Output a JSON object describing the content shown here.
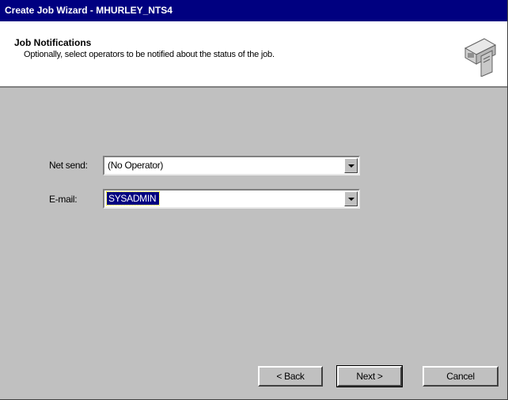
{
  "window": {
    "title": "Create Job Wizard - MHURLEY_NTS4"
  },
  "header": {
    "title": "Job Notifications",
    "subtitle": "Optionally, select operators to be notified about the status of the job.",
    "icon": "server-computer-icon"
  },
  "form": {
    "net_send": {
      "label": "Net send:",
      "value": "(No Operator)"
    },
    "email": {
      "label": "E-mail:",
      "value": "SYSADMIN"
    }
  },
  "buttons": {
    "back": "< Back",
    "next": "Next >",
    "cancel": "Cancel"
  },
  "colors": {
    "titlebar": "#000080",
    "face": "#c0c0c0",
    "selection": "#000080"
  }
}
